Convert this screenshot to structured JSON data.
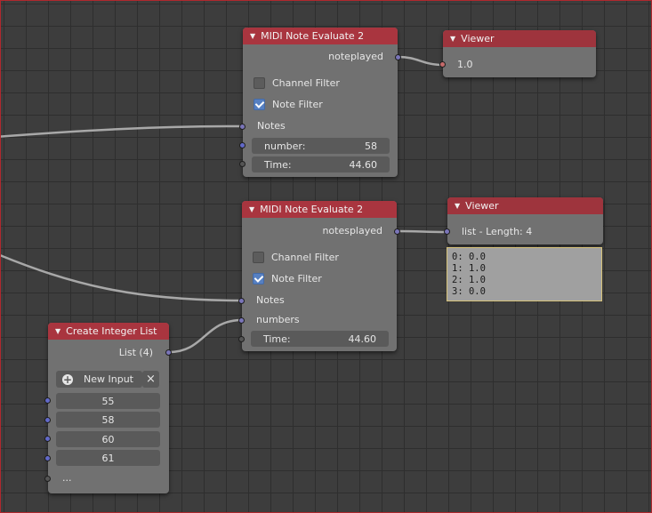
{
  "nodes": {
    "midi_eval_1": {
      "title": "MIDI Note Evaluate 2",
      "output_label": "noteplayed",
      "channel_filter_label": "Channel Filter",
      "channel_filter_checked": false,
      "note_filter_label": "Note Filter",
      "note_filter_checked": true,
      "notes_label": "Notes",
      "number_label": "number:",
      "number_value": "58",
      "time_label": "Time:",
      "time_value": "44.60"
    },
    "viewer_1": {
      "title": "Viewer",
      "value": "1.0"
    },
    "midi_eval_2": {
      "title": "MIDI Note Evaluate 2",
      "output_label": "notesplayed",
      "channel_filter_label": "Channel Filter",
      "channel_filter_checked": false,
      "note_filter_label": "Note Filter",
      "note_filter_checked": true,
      "notes_label": "Notes",
      "numbers_label": "numbers",
      "time_label": "Time:",
      "time_value": "44.60"
    },
    "viewer_2": {
      "title": "Viewer",
      "value": "list - Length: 4",
      "list_lines": [
        "0: 0.0",
        "1: 1.0",
        "2: 1.0",
        "3: 0.0"
      ]
    },
    "create_integer_list": {
      "title": "Create Integer List",
      "output_label": "List (4)",
      "new_input_label": "New Input",
      "remove_icon": "close-icon",
      "add_icon": "plus-circle-icon",
      "values": [
        "55",
        "58",
        "60",
        "61"
      ],
      "more_label": "..."
    }
  },
  "colors": {
    "header": "#a9353f",
    "node_body": "#717171",
    "socket_integer": "#6269c8",
    "socket_float": "#c46a6a",
    "checkbox_checked": "#5680c2"
  }
}
